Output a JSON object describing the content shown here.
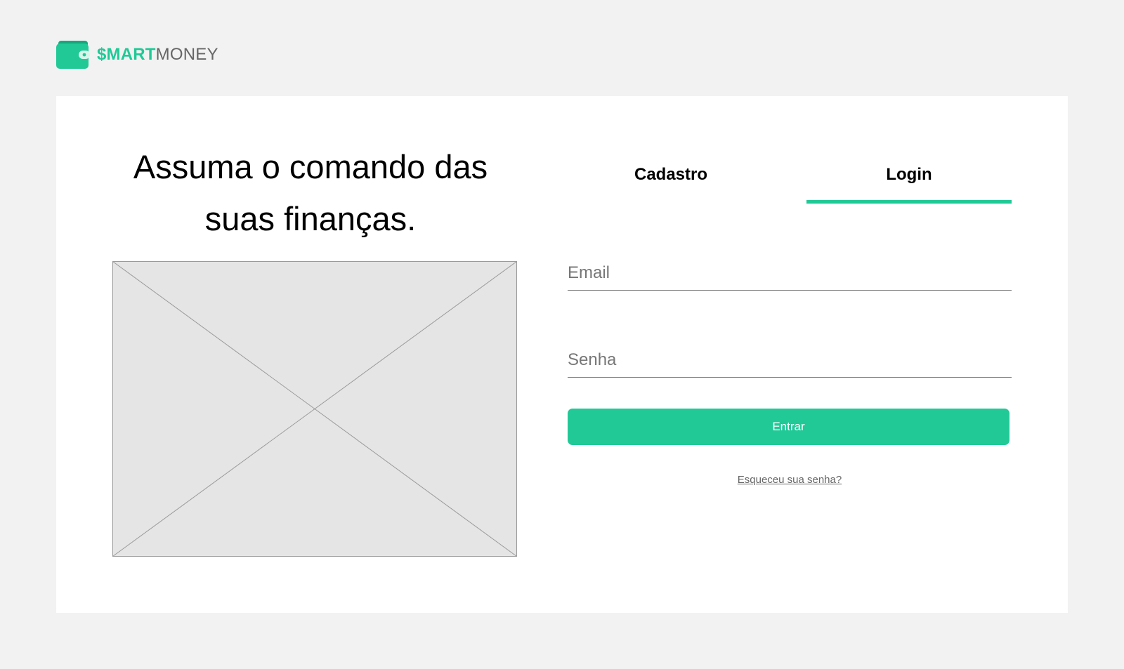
{
  "brand": {
    "icon": "wallet-icon",
    "name_bold": "$MART",
    "name_light": "MONEY",
    "accent_color": "#21c997"
  },
  "hero": {
    "headline": "Assuma o comando das suas finanças.",
    "image": "image-placeholder-icon"
  },
  "auth": {
    "tabs": [
      {
        "label": "Cadastro",
        "active": false
      },
      {
        "label": "Login",
        "active": true
      }
    ],
    "email": {
      "placeholder": "Email",
      "value": ""
    },
    "password": {
      "placeholder": "Senha",
      "value": ""
    },
    "submit_label": "Entrar",
    "forgot_label": "Esqueceu sua senha?"
  }
}
